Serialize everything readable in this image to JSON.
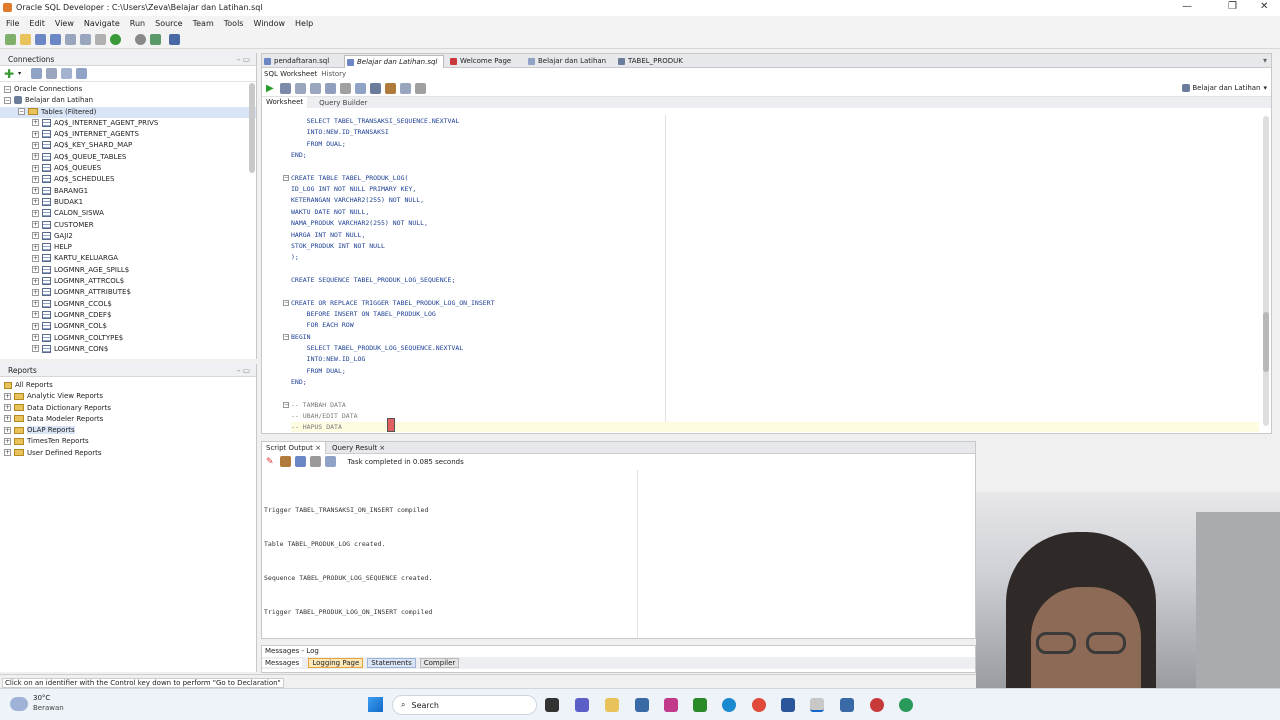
{
  "window": {
    "title": "Oracle SQL Developer : C:\\Users\\Zeva\\Belajar dan Latihan.sql"
  },
  "menu": [
    "File",
    "Edit",
    "View",
    "Navigate",
    "Run",
    "Source",
    "Team",
    "Tools",
    "Window",
    "Help"
  ],
  "connections_panel": {
    "title": "Connections",
    "root": "Oracle Connections",
    "connection": "Belajar dan Latihan",
    "tables_node": "Tables (Filtered)",
    "tables": [
      "AQ$_INTERNET_AGENT_PRIVS",
      "AQ$_INTERNET_AGENTS",
      "AQ$_KEY_SHARD_MAP",
      "AQ$_QUEUE_TABLES",
      "AQ$_QUEUES",
      "AQ$_SCHEDULES",
      "BARANG1",
      "BUDAK1",
      "CALON_SISWA",
      "CUSTOMER",
      "GAJI2",
      "HELP",
      "KARTU_KELUARGA",
      "LOGMNR_AGE_SPILL$",
      "LOGMNR_ATTRCOL$",
      "LOGMNR_ATTRIBUTE$",
      "LOGMNR_CCOL$",
      "LOGMNR_CDEF$",
      "LOGMNR_COL$",
      "LOGMNR_COLTYPE$",
      "LOGMNR_CON$"
    ]
  },
  "reports_panel": {
    "title": "Reports",
    "items": [
      "All Reports",
      "Analytic View Reports",
      "Data Dictionary Reports",
      "Data Modeler Reports",
      "OLAP Reports",
      "TimesTen Reports",
      "User Defined Reports"
    ]
  },
  "document_tabs": [
    "pendaftaran.sql",
    "Belajar dan Latihan.sql",
    "Welcome Page",
    "Belajar dan Latihan",
    "TABEL_PRODUK"
  ],
  "editor": {
    "subtabs": [
      "SQL Worksheet",
      "History"
    ],
    "connection_selector": "Belajar dan Latihan",
    "mode_tabs": [
      "Worksheet",
      "Query Builder"
    ],
    "code_lines": [
      "    SELECT TABEL_TRANSAKSI_SEQUENCE.NEXTVAL",
      "    INTO:NEW.ID_TRANSAKSI",
      "    FROM DUAL;",
      "END;",
      "",
      "CREATE TABLE TABEL_PRODUK_LOG(",
      "ID_LOG INT NOT NULL PRIMARY KEY,",
      "KETERANGAN VARCHAR2(255) NOT NULL,",
      "WAKTU DATE NOT NULL,",
      "NAMA_PRODUK VARCHAR2(255) NOT NULL,",
      "HARGA INT NOT NULL,",
      "STOK_PRODUK INT NOT NULL",
      ");",
      "",
      "CREATE SEQUENCE TABEL_PRODUK_LOG_SEQUENCE;",
      "",
      "CREATE OR REPLACE TRIGGER TABEL_PRODUK_LOG_ON_INSERT",
      "    BEFORE INSERT ON TABEL_PRODUK_LOG",
      "    FOR EACH ROW",
      "BEGIN",
      "    SELECT TABEL_PRODUK_LOG_SEQUENCE.NEXTVAL",
      "    INTO:NEW.ID_LOG",
      "    FROM DUAL;",
      "END;",
      "",
      "-- TAMBAH DATA",
      "-- UBAH/EDIT DATA",
      "-- HAPUS DATA"
    ]
  },
  "output": {
    "tabs": [
      "Script Output",
      "Query Result"
    ],
    "task_status": "Task completed in 0.085 seconds",
    "lines": [
      "Trigger TABEL_TRANSAKSI_ON_INSERT compiled",
      "Table TABEL_PRODUK_LOG created.",
      "Sequence TABEL_PRODUK_LOG_SEQUENCE created.",
      "Trigger TABEL_PRODUK_LOG_ON_INSERT compiled"
    ]
  },
  "messages": {
    "title": "Messages - Log",
    "tabs": [
      "Messages",
      "Logging Page",
      "Statements",
      "Compiler"
    ]
  },
  "statusbar": {
    "hint": "Click on an identifier with the Control key down to perform \"Go to Declaration\""
  },
  "taskbar": {
    "temperature": "30°C",
    "weather": "Berawan",
    "search_label": "Search"
  },
  "colors": {
    "keyword_blue": "#1c3f94",
    "comment_gray": "#7a7a7a",
    "accent_orange": "#e8a33a"
  }
}
